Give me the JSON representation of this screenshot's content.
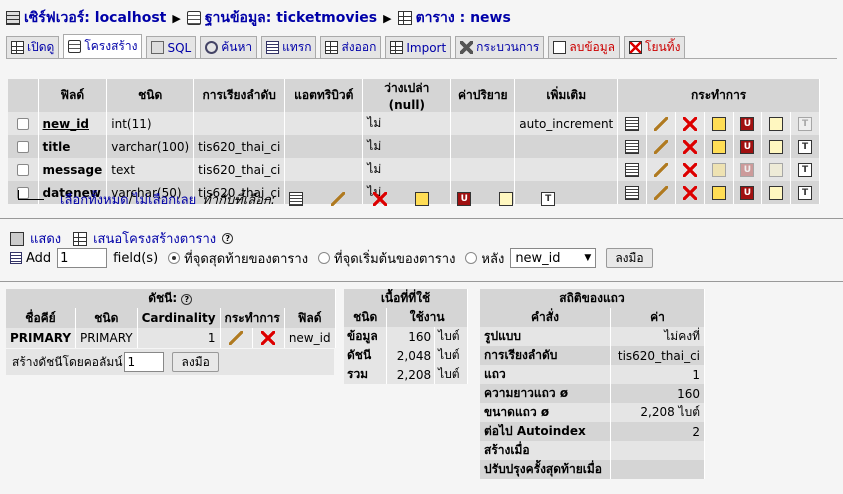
{
  "breadcrumb": {
    "server_label": "เซิร์ฟเวอร์: localhost",
    "db_label": "ฐานข้อมูล: ticketmovies",
    "table_label": "ตาราง : news"
  },
  "tabs": [
    {
      "label": "เปิดดู",
      "icon": "browse-icon"
    },
    {
      "label": "โครงสร้าง",
      "icon": "structure-icon"
    },
    {
      "label": "SQL",
      "icon": "sql-icon"
    },
    {
      "label": "ค้นหา",
      "icon": "search-icon"
    },
    {
      "label": "แทรก",
      "icon": "insert-icon"
    },
    {
      "label": "ส่งออก",
      "icon": "export-icon"
    },
    {
      "label": "Import",
      "icon": "import-icon"
    },
    {
      "label": "กระบวนการ",
      "icon": "operations-icon"
    },
    {
      "label": "ลบข้อมูล",
      "icon": "empty-icon"
    },
    {
      "label": "โยนทิ้ง",
      "icon": "drop-icon"
    }
  ],
  "structure": {
    "headers": [
      "ฟิลด์",
      "ชนิด",
      "การเรียงลำดับ",
      "แอตทริบิวต์",
      "ว่างเปล่า (null)",
      "ค่าปริยาย",
      "เพิ่มเติม",
      "กระทำการ"
    ],
    "rows": [
      {
        "field": "new_id",
        "type": "int(11)",
        "collation": "",
        "attributes": "",
        "null": "ไม่",
        "default": "",
        "extra": "auto_increment"
      },
      {
        "field": "title",
        "type": "varchar(100)",
        "collation": "tis620_thai_ci",
        "attributes": "",
        "null": "ไม่",
        "default": "",
        "extra": ""
      },
      {
        "field": "message",
        "type": "text",
        "collation": "tis620_thai_ci",
        "attributes": "",
        "null": "ไม่",
        "default": "",
        "extra": ""
      },
      {
        "field": "datenew",
        "type": "varchar(50)",
        "collation": "tis620_thai_ci",
        "attributes": "",
        "null": "ไม่",
        "default": "",
        "extra": ""
      }
    ]
  },
  "with_selected": {
    "check_all": "เลือกทั้งหมด",
    "sep": " / ",
    "uncheck_all": "ไม่เลือกเลย",
    "label": "ทำกับที่เลือก:"
  },
  "links": {
    "print_view": "แสดง",
    "propose_structure": "เสนอโครงสร้างตาราง"
  },
  "add_field": {
    "add_label": "Add",
    "count": "1",
    "fields_label": "field(s)",
    "opt_end": "ที่จุดสุดท้ายของตาราง",
    "opt_begin": "ที่จุดเริ่มต้นของตาราง",
    "opt_after": "หลัง",
    "after_value": "new_id",
    "go": "ลงมือ"
  },
  "indexes": {
    "title": "ดัชนี:",
    "headers": [
      "ชื่อคีย์",
      "ชนิด",
      "Cardinality",
      "กระทำการ",
      "ฟิลด์"
    ],
    "row": {
      "keyname": "PRIMARY",
      "type": "PRIMARY",
      "cardinality": "1",
      "field": "new_id"
    },
    "create_label": "สร้างดัชนีโดยคอลัมน์",
    "create_count": "1",
    "create_go": "ลงมือ"
  },
  "space": {
    "title": "เนื้อที่ที่ใช้",
    "headers": [
      "ชนิด",
      "ใช้งาน"
    ],
    "rows": [
      {
        "type": "ข้อมูล",
        "value": "160",
        "unit": "ไบต์"
      },
      {
        "type": "ดัชนี",
        "value": "2,048",
        "unit": "ไบต์"
      },
      {
        "type": "รวม",
        "value": "2,208",
        "unit": "ไบต์"
      }
    ]
  },
  "row_stats": {
    "title": "สถิติของแถว",
    "headers": [
      "คำสั่ง",
      "ค่า"
    ],
    "rows": [
      {
        "label": "รูปแบบ",
        "value": "ไม่คงที่"
      },
      {
        "label": "การเรียงลำดับ",
        "value": "tis620_thai_ci"
      },
      {
        "label": "แถว",
        "value": "1"
      },
      {
        "label": "ความยาวแถว ø",
        "value": "160"
      },
      {
        "label": "ขนาดแถว ø",
        "value": "2,208 ไบต์"
      },
      {
        "label": "ต่อไป Autoindex",
        "value": "2"
      },
      {
        "label": "สร้างเมื่อ",
        "value": ""
      },
      {
        "label": "ปรับปรุงครั้งสุดท้ายเมื่อ",
        "value": ""
      }
    ]
  }
}
